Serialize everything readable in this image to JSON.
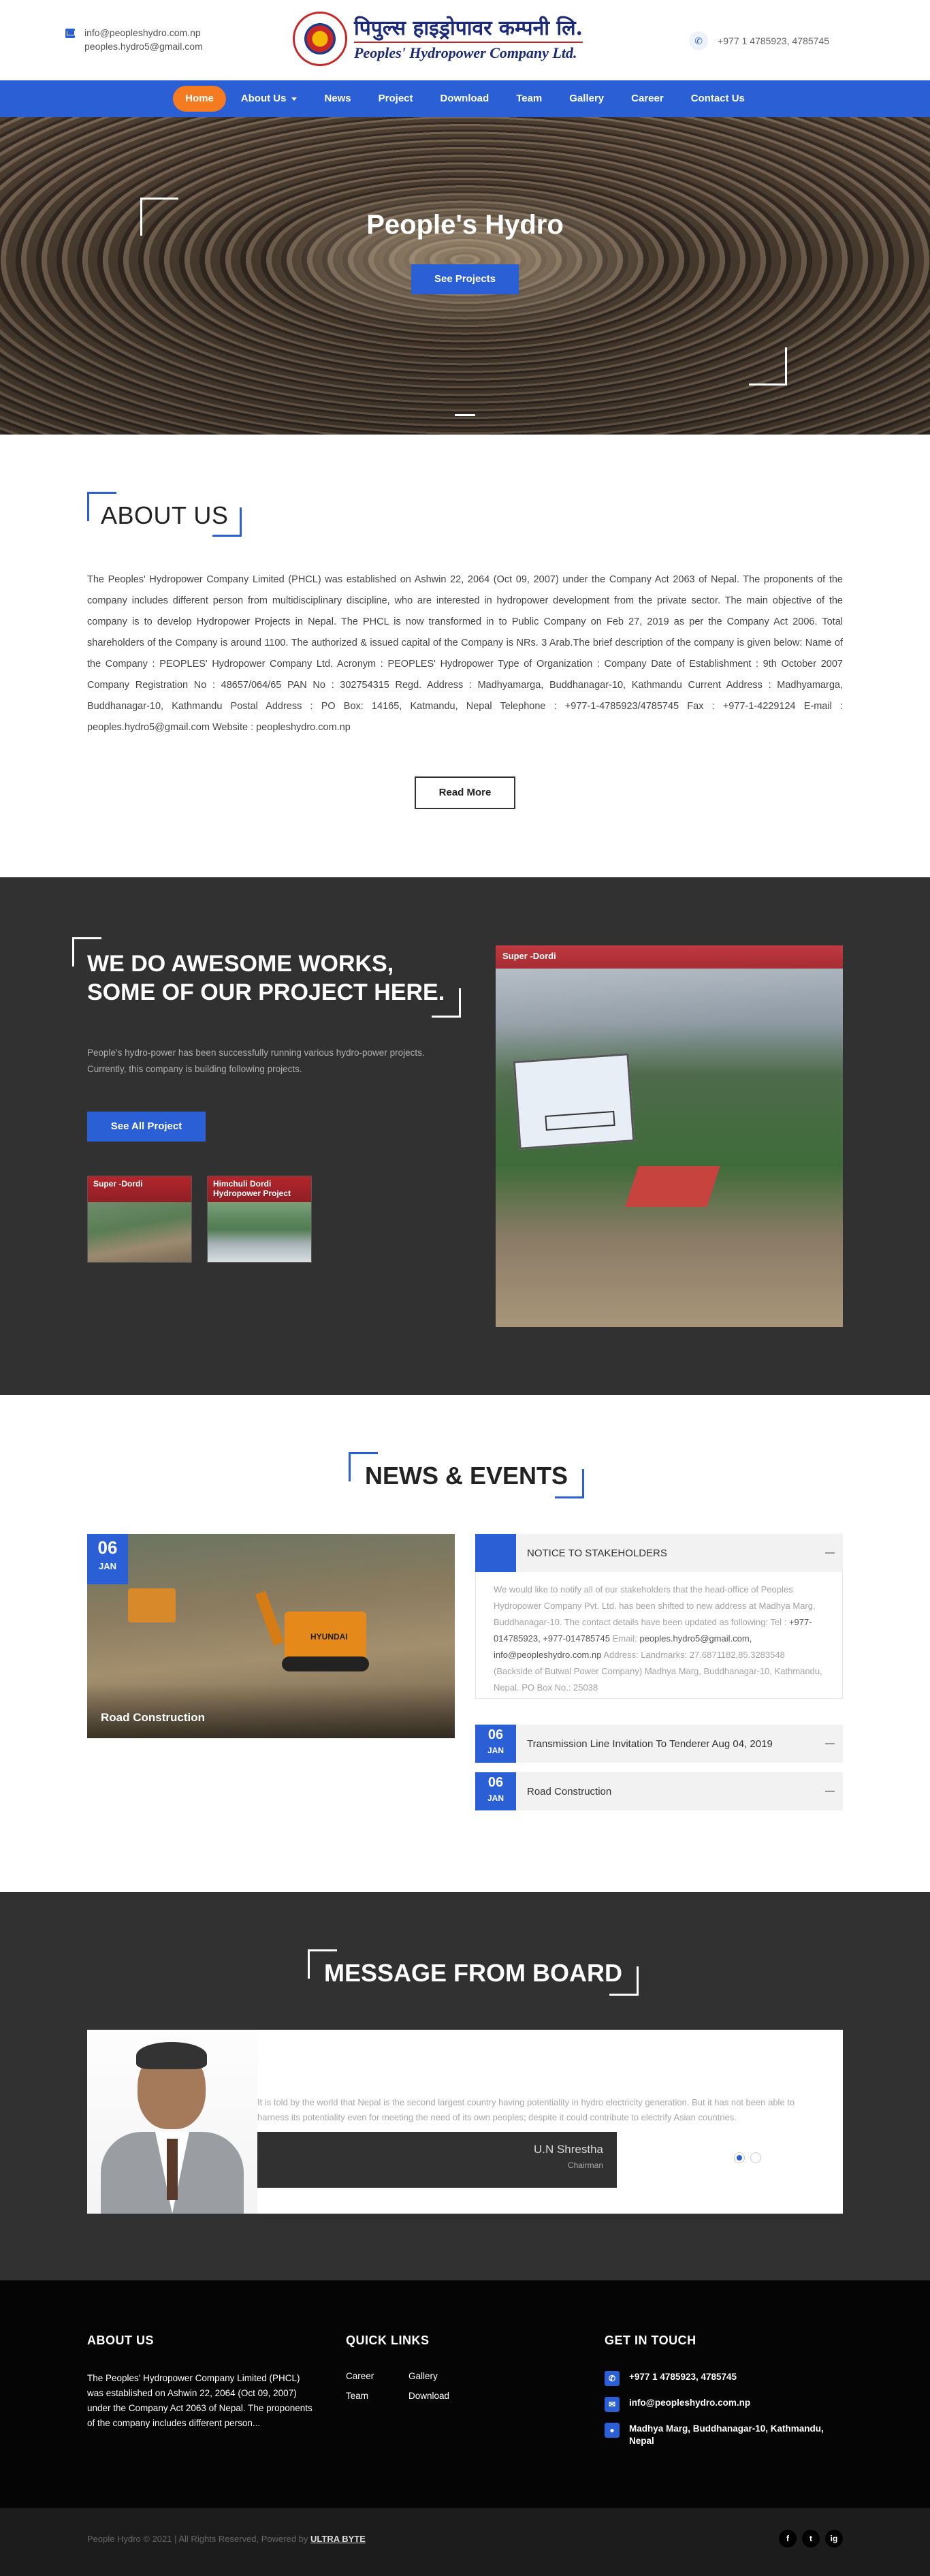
{
  "header": {
    "email_1": "info@peopleshydro.com.np",
    "email_2": "peoples.hydro5@gmail.com",
    "logo_np": "पिपुल्स हाइड्रोपावर कम्पनी लि.",
    "logo_en": "Peoples' Hydropower Company Ltd.",
    "phone": "+977 1 4785923, 4785745"
  },
  "nav": {
    "items": [
      "Home",
      "About Us",
      "News",
      "Project",
      "Download",
      "Team",
      "Gallery",
      "Career",
      "Contact Us"
    ],
    "active": "Home"
  },
  "hero": {
    "title": "People's Hydro",
    "button": "See Projects"
  },
  "about": {
    "title": "ABOUT US",
    "text": "The Peoples' Hydropower Company Limited (PHCL) was established on Ashwin 22, 2064 (Oct 09, 2007) under the Company Act 2063 of Nepal. The proponents of the company includes different person from multidisciplinary discipline, who are interested in hydropower development from the private sector. The main objective of the company is to develop Hydropower Projects in Nepal. The PHCL is now transformed in to Public Company on Feb 27, 2019 as per the Company Act 2006. Total shareholders of the Company is around 1100. The authorized & issued capital of the Company is NRs. 3 Arab.The brief description of the company is given below: Name of the Company : PEOPLES' Hydropower Company Ltd. Acronym : PEOPLES' Hydropower Type of Organization : Company Date of Establishment : 9th October 2007 Company Registration No : 48657/064/65 PAN No : 302754315 Regd. Address : Madhyamarga, Buddhanagar-10, Kathmandu Current Address : Madhyamarga, Buddhanagar-10, Kathmandu Postal Address : PO Box: 14165, Katmandu, Nepal Telephone : +977-1-4785923/4785745 Fax : +977-1-4229124 E-mail : peoples.hydro5@gmail.com Website : peopleshydro.com.np",
    "button": "Read More"
  },
  "works": {
    "title_line1": "WE DO AWESOME WORKS,",
    "title_line2": "SOME OF OUR PROJECT HERE.",
    "desc": "People's hydro-power has been successfully running various hydro-power projects. Currently, this company is building following projects.",
    "button": "See All Project",
    "thumbs": [
      "Super -Dordi",
      "Himchuli Dordi Hydropower Project"
    ],
    "featured": "Super -Dordi"
  },
  "news": {
    "title": "NEWS & EVENTS",
    "card": {
      "day": "06",
      "month": "JAN",
      "caption": "Road Construction"
    },
    "accordion": [
      {
        "day": "",
        "month": "",
        "title": "NOTICE TO STAKEHOLDERS"
      },
      {
        "day": "06",
        "month": "JAN",
        "title": "Transmission Line Invitation To Tenderer Aug 04, 2019"
      },
      {
        "day": "06",
        "month": "JAN",
        "title": "Road Construction"
      }
    ],
    "notice_body_1": "We would like to notify all of our stakeholders that the head-office of Peoples Hydropower Company Pvt. Ltd. has been shifted to new address at Madhya Marg, Buddhanagar-10. The contact details have been updated as following: Tel :",
    "notice_tel": "+977-014785923, +977-014785745",
    "notice_email_label": "Email:",
    "notice_email": "peoples.hydro5@gmail.com, info@peopleshydro.com.np",
    "notice_body_2": "Address: Landmarks: 27.6871182,85.3283548 (Backside of Butwal Power Company) Madhya Marg, Buddhanagar-10, Kathmandu, Nepal. PO Box No.: 25038"
  },
  "board": {
    "title": "MESSAGE FROM BOARD",
    "quote": "It is told by the world that Nepal is the second largest country having potentiality in hydro electricity generation. But it has not been able to harness its potentiality even for meeting the need of its own peoples; despite it could contribute to electrify Asian countries.",
    "name": "U.N Shrestha",
    "role": "Chairman"
  },
  "footer": {
    "about_title": "ABOUT US",
    "about_text": "The Peoples' Hydropower Company Limited (PHCL) was established on Ashwin 22, 2064 (Oct 09, 2007) under the Company Act 2063 of Nepal. The proponents of the company includes different person...",
    "links_title": "QUICK LINKS",
    "links": [
      "Career",
      "Gallery",
      "Team",
      "Download"
    ],
    "touch_title": "GET IN TOUCH",
    "phone": "+977 1 4785923, 4785745",
    "email": "info@peopleshydro.com.np",
    "address": "Madhya Marg, Buddhanagar-10, Kathmandu, Nepal",
    "copyright": "People Hydro © 2021 | All Rights Reserved, Powered by",
    "powered_by": "ULTRA BYTE",
    "social": [
      "f",
      "t",
      "ig"
    ]
  },
  "colors": {
    "primary": "#2a5fd6",
    "accent": "#f47b20",
    "dark": "#313131"
  }
}
